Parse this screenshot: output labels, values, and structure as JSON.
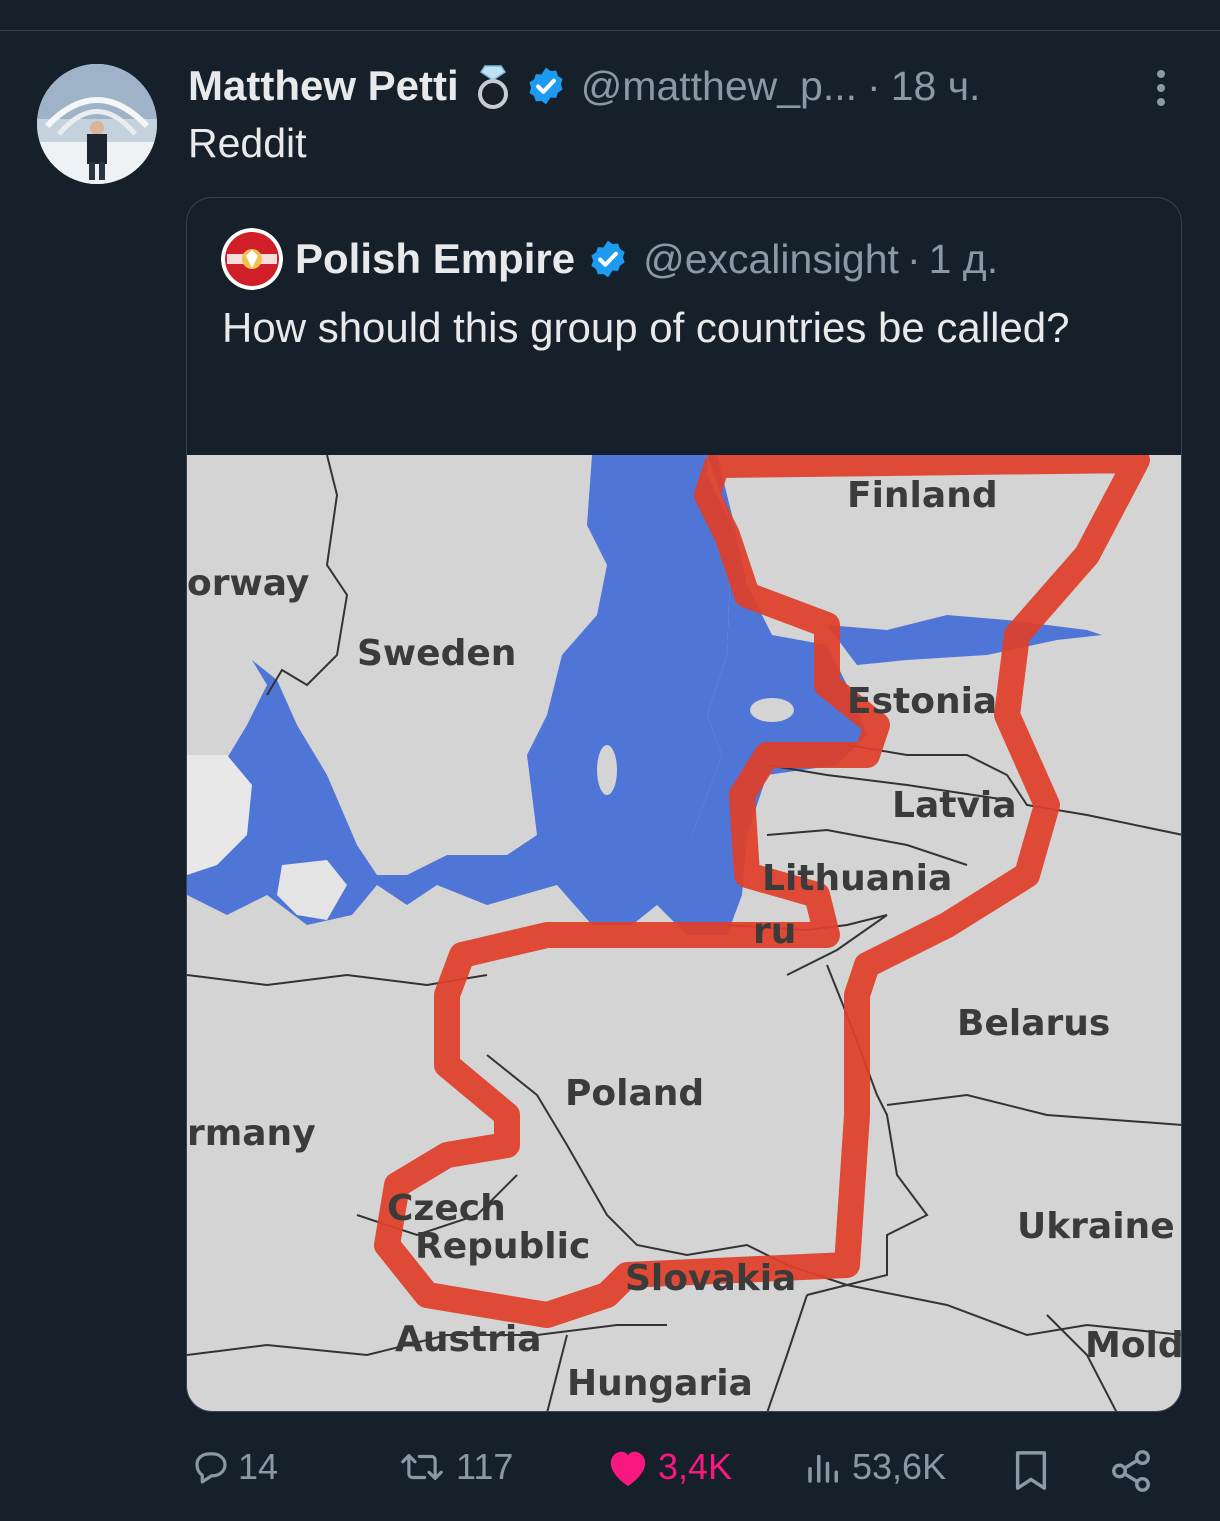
{
  "tweet": {
    "author_name": "Matthew Petti",
    "author_handle": "@matthew_p...",
    "separator": "·",
    "time": "18 ч.",
    "text": "Reddit"
  },
  "quote": {
    "author_name": "Polish Empire",
    "author_handle": "@excalinsight",
    "separator": "·",
    "time": "1 д.",
    "text": "How should this group of countries be called?"
  },
  "map": {
    "labels": {
      "finland": "Finland",
      "norway": "orway",
      "sweden": "Sweden",
      "estonia": "Estonia",
      "latvia": "Latvia",
      "lithuania": "Lithuania",
      "ru": "ru",
      "belarus": "Belarus",
      "poland": "Poland",
      "germany": "rmany",
      "czech_1": "Czech",
      "czech_2": "Republic",
      "slovakia": "Slovakia",
      "ukraine": "Ukraine",
      "austria": "Austria",
      "hungary": "Hungaria",
      "moldova": "Mold"
    },
    "colors": {
      "sea": "#4f75d6",
      "land": "#d4d4d4",
      "circle": "#e0402a"
    }
  },
  "actions": {
    "replies": "14",
    "retweets": "117",
    "likes": "3,4K",
    "views": "53,6K"
  },
  "colors": {
    "background": "#15202b",
    "verified": "#1d9bf0",
    "like": "#f91880",
    "muted": "#8b98a5"
  }
}
